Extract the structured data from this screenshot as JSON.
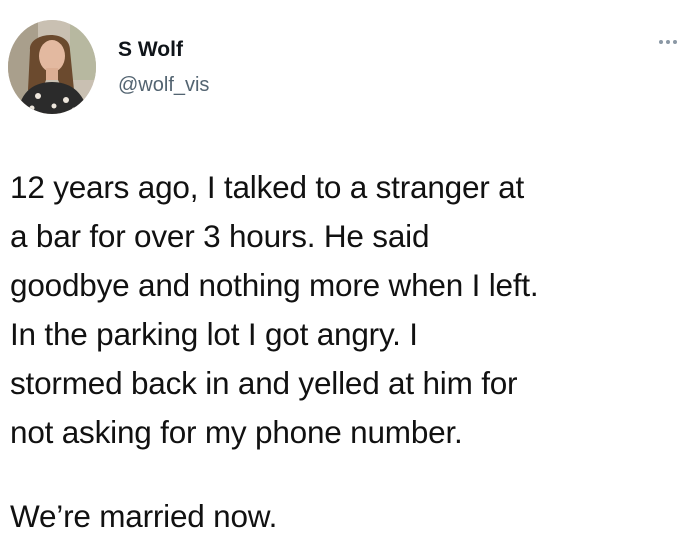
{
  "author": {
    "display_name": "S Wolf",
    "handle": "@wolf_vis",
    "avatar_icon": "profile-photo-woman"
  },
  "more_icon": "more-horizontal-icon",
  "tweet": {
    "lines": [
      "12 years ago, I talked to a stranger at",
      "a bar for over 3 hours. He said",
      "goodbye and nothing more when I left.",
      "In the parking lot I got angry. I",
      "stormed back in and yelled at him for",
      "not asking for my phone number."
    ],
    "second_paragraph": "We’re married now."
  },
  "colors": {
    "name": "#0f1419",
    "handle": "#536471",
    "text": "#111111",
    "icon": "#8b98a5"
  }
}
